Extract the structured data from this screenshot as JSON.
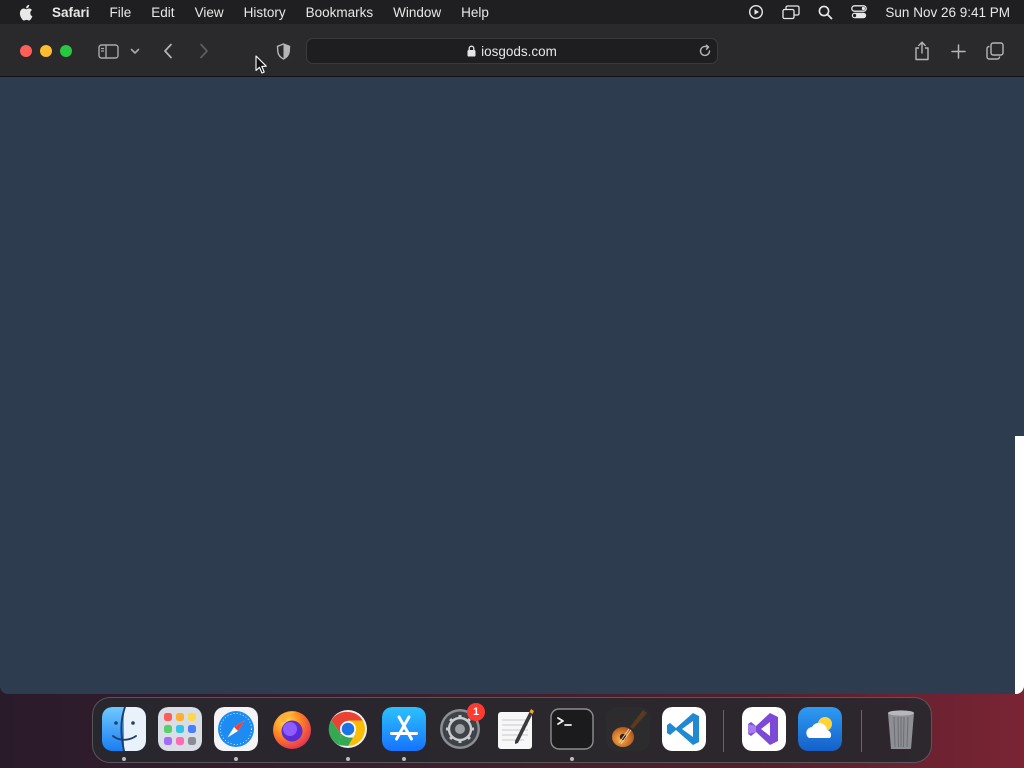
{
  "menubar": {
    "app_name": "Safari",
    "items": [
      "File",
      "Edit",
      "View",
      "History",
      "Bookmarks",
      "Window",
      "Help"
    ],
    "clock": "Sun Nov 26  9:41 PM",
    "status_icons": [
      "screen-recording-icon",
      "screen-mirroring-icon",
      "spotlight-search-icon",
      "control-center-icon"
    ]
  },
  "browser": {
    "url": "iosgods.com",
    "content_color": "#2e3c4f"
  },
  "dock": {
    "apps": [
      {
        "name": "finder-icon",
        "running": true
      },
      {
        "name": "launchpad-icon",
        "running": false
      },
      {
        "name": "safari-icon",
        "running": true
      },
      {
        "name": "firefox-icon",
        "running": false
      },
      {
        "name": "chrome-icon",
        "running": true
      },
      {
        "name": "app-store-icon",
        "running": true
      },
      {
        "name": "system-settings-icon",
        "running": false,
        "badge": "1"
      },
      {
        "name": "textedit-icon",
        "running": false
      },
      {
        "name": "terminal-icon",
        "running": true
      },
      {
        "name": "garageband-icon",
        "running": false
      },
      {
        "name": "vscode-icon",
        "running": false
      },
      {
        "name": "visual-studio-icon",
        "running": false
      },
      {
        "name": "weather-icon",
        "running": false
      },
      {
        "name": "trash-icon",
        "running": false
      }
    ]
  },
  "colors": {
    "close": "#ff5f57",
    "minimize": "#febc2e",
    "maximize": "#28c840",
    "badge": "#ff3b30"
  }
}
